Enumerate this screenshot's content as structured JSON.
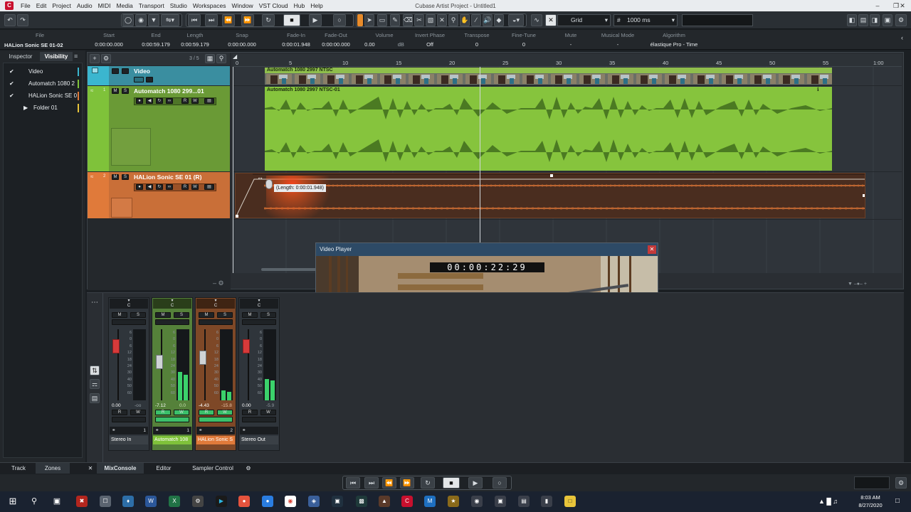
{
  "app": {
    "window_title": "Cubase Artist Project - Untitled1",
    "menus": [
      "File",
      "Edit",
      "Project",
      "Audio",
      "MIDI",
      "Media",
      "Transport",
      "Studio",
      "Workspaces",
      "Window",
      "VST Cloud",
      "Hub",
      "Help"
    ]
  },
  "toolbar": {
    "snap_type": "Grid",
    "grid_value": "1000 ms"
  },
  "infoline": {
    "selected_event": "HALion Sonic SE 01-02",
    "fields": [
      {
        "label": "File",
        "value": ""
      },
      {
        "label": "Start",
        "value": "0:00:00.000"
      },
      {
        "label": "End",
        "value": "0:00:59.179"
      },
      {
        "label": "Length",
        "value": "0:00:59.179"
      },
      {
        "label": "Snap",
        "value": "0:00:00.000"
      },
      {
        "label": "Fade-In",
        "value": "0:00:01.948"
      },
      {
        "label": "Fade-Out",
        "value": "0:00:00.000"
      },
      {
        "label": "Volume",
        "value": "0.00",
        "unit": "dB"
      },
      {
        "label": "Invert Phase",
        "value": "Off"
      },
      {
        "label": "Transpose",
        "value": "0"
      },
      {
        "label": "Fine-Tune",
        "value": "0"
      },
      {
        "label": "Mute",
        "value": "-"
      },
      {
        "label": "Musical Mode",
        "value": "-"
      },
      {
        "label": "Algorithm",
        "value": "élastique Pro - Time"
      }
    ]
  },
  "leftzone": {
    "tabs": [
      "Inspector",
      "Visibility"
    ],
    "active_tab": "Visibility",
    "items": [
      {
        "label": "Video",
        "checked": true
      },
      {
        "label": "Automatch 1080 2",
        "checked": true
      },
      {
        "label": "HALion Sonic SE 0",
        "checked": true
      },
      {
        "label": "Folder 01",
        "checked": false
      }
    ]
  },
  "project": {
    "track_count": "3 / 5",
    "tracks": [
      {
        "num": "",
        "name": "Video",
        "color": "#3bb6cf"
      },
      {
        "num": "1",
        "name": "Automatch 1080 299...01",
        "color": "#7fc23a"
      },
      {
        "num": "2",
        "name": "HALion Sonic SE 01 (R)",
        "color": "#e07a3a"
      }
    ],
    "ruler_labels": [
      "0",
      "5",
      "10",
      "15",
      "20",
      "25",
      "30",
      "35",
      "40",
      "45",
      "50",
      "55",
      "1:00"
    ],
    "video_event_label": "Automatch 1080 2997 NTSC",
    "audio_event_label": "Automatch 1080 2997 NTSC-01",
    "fade_tooltip": "(Length: 0:00:01.948)"
  },
  "videoplayer": {
    "title": "Video Player",
    "timecode": "00:00:22:29"
  },
  "mixer": {
    "strips": [
      {
        "name": "Stereo In",
        "value": "0.00",
        "peak": "-oo",
        "number": "1",
        "color": "#2f353b"
      },
      {
        "name": "Automatch 108",
        "value": "-7.12",
        "peak": "0.0",
        "number": "1",
        "color": "#5e8a3a"
      },
      {
        "name": "HALion Sonic S",
        "value": "-4.43",
        "peak": "-15.8",
        "number": "2",
        "color": "#8a4e2b"
      },
      {
        "name": "Stereo Out",
        "value": "0.00",
        "peak": "-5.9",
        "number": "",
        "color": "#2f353b"
      }
    ],
    "pan_label": "C",
    "scale": [
      "6",
      "0",
      "6",
      "12",
      "18",
      "24",
      "30",
      "40",
      "50",
      "60",
      "80"
    ]
  },
  "bottomtabs": {
    "left": [
      "Track",
      "Zones"
    ],
    "right": [
      "MixConsole",
      "Editor",
      "Sampler Control"
    ]
  },
  "taskbar": {
    "time": "8:03 AM",
    "date": "8/27/2020"
  },
  "colors": {
    "video_track": "#3bb6cf",
    "audio_track": "#7fc23a",
    "instrument_track": "#e07a3a",
    "accent": "#e88b2a"
  }
}
